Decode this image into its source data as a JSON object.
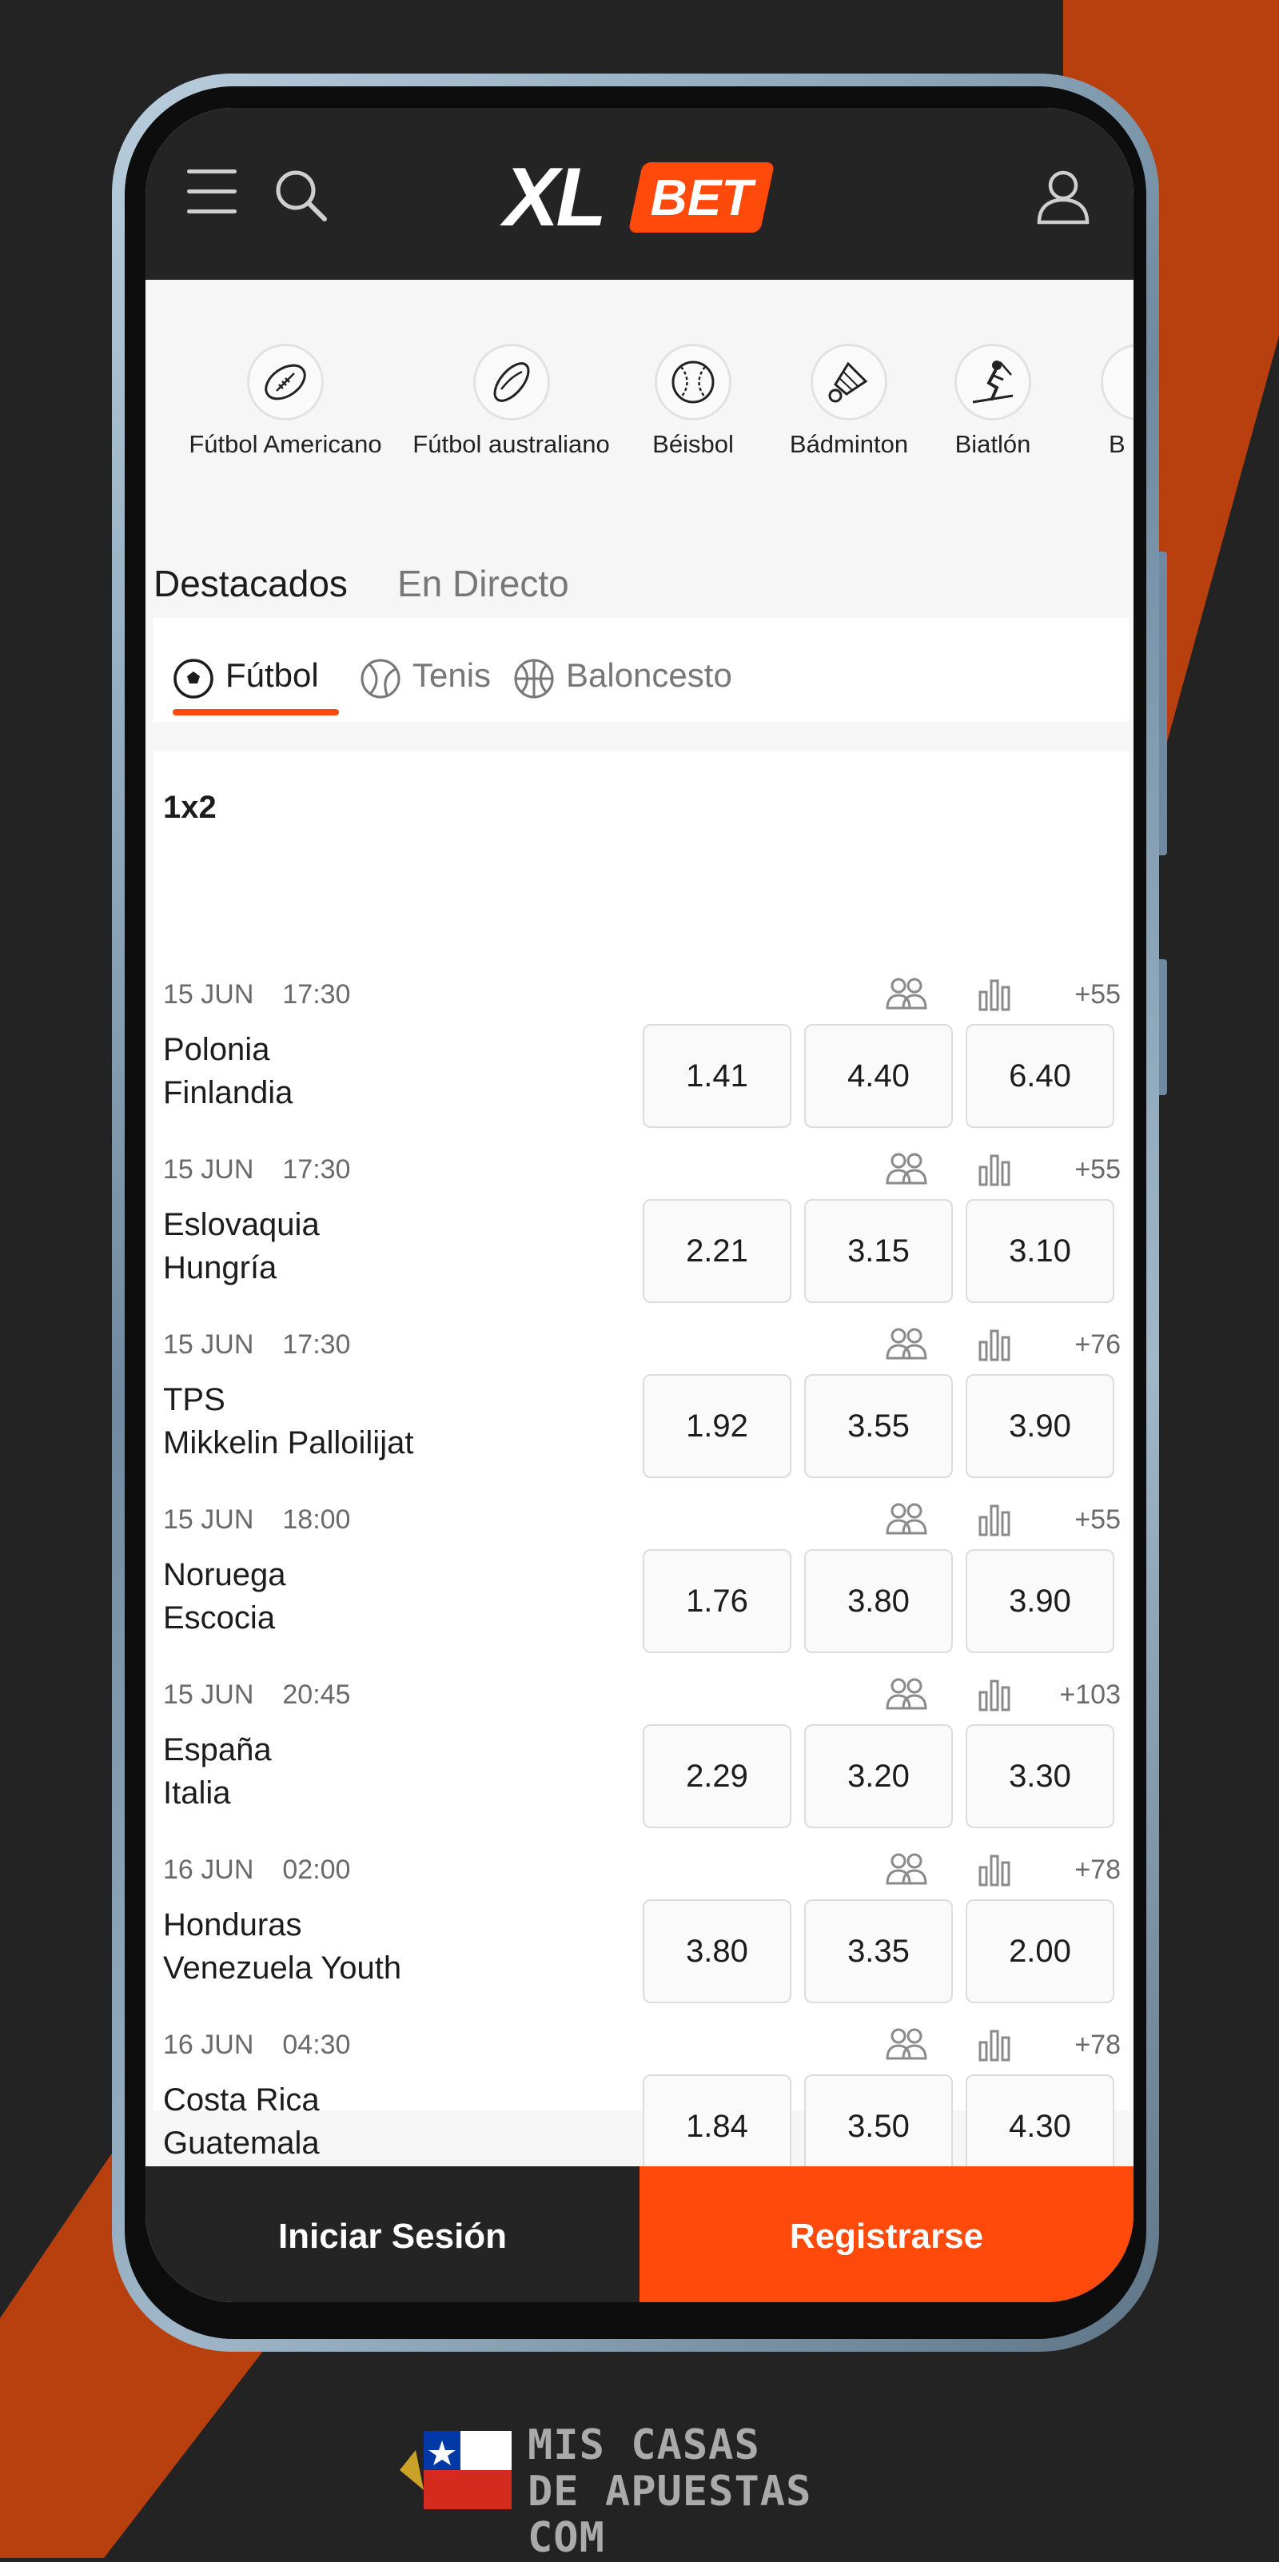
{
  "colors": {
    "accent": "#ff4a0c",
    "header_bg": "#242424",
    "page_bg": "#232323",
    "stripe": "#b8400f"
  },
  "header": {
    "logo_xl": "XL",
    "logo_bet": "BET",
    "menu_icon": "hamburger-menu-icon",
    "search_icon": "search-icon",
    "user_icon": "user-account-icon"
  },
  "sports": [
    {
      "label": "Fútbol Americano",
      "icon": "american-football-icon"
    },
    {
      "label": "Fútbol australiano",
      "icon": "australian-football-icon"
    },
    {
      "label": "Béisbol",
      "icon": "baseball-icon"
    },
    {
      "label": "Bádminton",
      "icon": "shuttlecock-icon"
    },
    {
      "label": "Biatlón",
      "icon": "biathlon-icon"
    },
    {
      "label": "B",
      "icon": "partial-sport-icon"
    }
  ],
  "main_tabs": {
    "featured": "Destacados",
    "live": "En Directo"
  },
  "sport_tabs": [
    {
      "label": "Fútbol",
      "icon": "soccer-ball-icon",
      "active": true
    },
    {
      "label": "Tenis",
      "icon": "tennis-ball-icon",
      "active": false
    },
    {
      "label": "Baloncesto",
      "icon": "basketball-icon",
      "active": false
    }
  ],
  "market": {
    "title": "1x2"
  },
  "events": [
    {
      "date": "15 JUN",
      "time": "17:30",
      "more": "+55",
      "home": "Polonia",
      "away": "Finlandia",
      "odds": [
        "1.41",
        "4.40",
        "6.40"
      ]
    },
    {
      "date": "15 JUN",
      "time": "17:30",
      "more": "+55",
      "home": "Eslovaquia",
      "away": "Hungría",
      "odds": [
        "2.21",
        "3.15",
        "3.10"
      ]
    },
    {
      "date": "15 JUN",
      "time": "17:30",
      "more": "+76",
      "home": "TPS",
      "away": "Mikkelin Palloilijat",
      "odds": [
        "1.92",
        "3.55",
        "3.90"
      ]
    },
    {
      "date": "15 JUN",
      "time": "18:00",
      "more": "+55",
      "home": "Noruega",
      "away": "Escocia",
      "odds": [
        "1.76",
        "3.80",
        "3.90"
      ]
    },
    {
      "date": "15 JUN",
      "time": "20:45",
      "more": "+103",
      "home": "España",
      "away": "Italia",
      "odds": [
        "2.29",
        "3.20",
        "3.30"
      ]
    },
    {
      "date": "16 JUN",
      "time": "02:00",
      "more": "+78",
      "home": "Honduras",
      "away": "Venezuela Youth",
      "odds": [
        "3.80",
        "3.35",
        "2.00"
      ]
    },
    {
      "date": "16 JUN",
      "time": "04:30",
      "more": "+78",
      "home": "Costa Rica",
      "away": "Guatemala",
      "odds": [
        "1.84",
        "3.50",
        "4.30"
      ]
    }
  ],
  "footer": {
    "login": "Iniciar Sesión",
    "register": "Registrarse"
  },
  "watermark": {
    "line1": "MIS CASAS",
    "line2": "DE APUESTAS COM"
  }
}
